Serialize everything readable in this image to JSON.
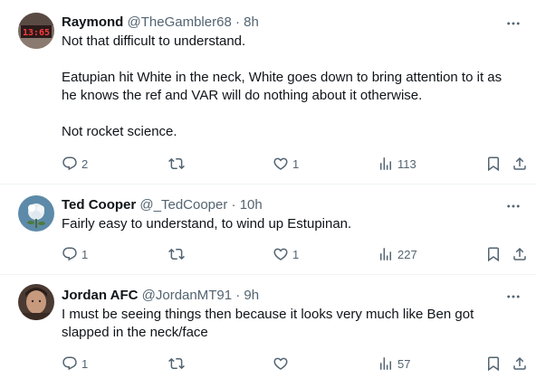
{
  "tweets": [
    {
      "name": "Raymond",
      "handle": "@TheGambler68",
      "separator": "·",
      "time": "8h",
      "paragraphs": [
        "Not that difficult to understand.",
        "",
        "Eatupian hit White in the neck, White goes down to bring attention to it as he knows the ref and VAR will do nothing about it otherwise.",
        "",
        "Not rocket science."
      ],
      "replies": "2",
      "retweets": "",
      "likes": "1",
      "views": "113"
    },
    {
      "name": "Ted Cooper",
      "handle": "@_TedCooper",
      "separator": "·",
      "time": "10h",
      "paragraphs": [
        "Fairly easy to understand, to wind up Estupinan."
      ],
      "replies": "1",
      "retweets": "",
      "likes": "1",
      "views": "227"
    },
    {
      "name": "Jordan AFC",
      "handle": "@JordanMT91",
      "separator": "·",
      "time": "9h",
      "paragraphs": [
        "I must be seeing things then because it looks very much like Ben got slapped in the neck/face"
      ],
      "replies": "1",
      "retweets": "",
      "likes": "",
      "views": "57"
    }
  ],
  "avatars": {
    "t1_sign_text": "13:65"
  },
  "icons": {
    "more": "more-icon",
    "reply": "reply-icon",
    "retweet": "retweet-icon",
    "like": "like-icon",
    "views": "views-icon",
    "bookmark": "bookmark-icon",
    "share": "share-icon"
  },
  "colors": {
    "text": "#0f1419",
    "secondary": "#536471",
    "divider": "#eff3f4"
  }
}
